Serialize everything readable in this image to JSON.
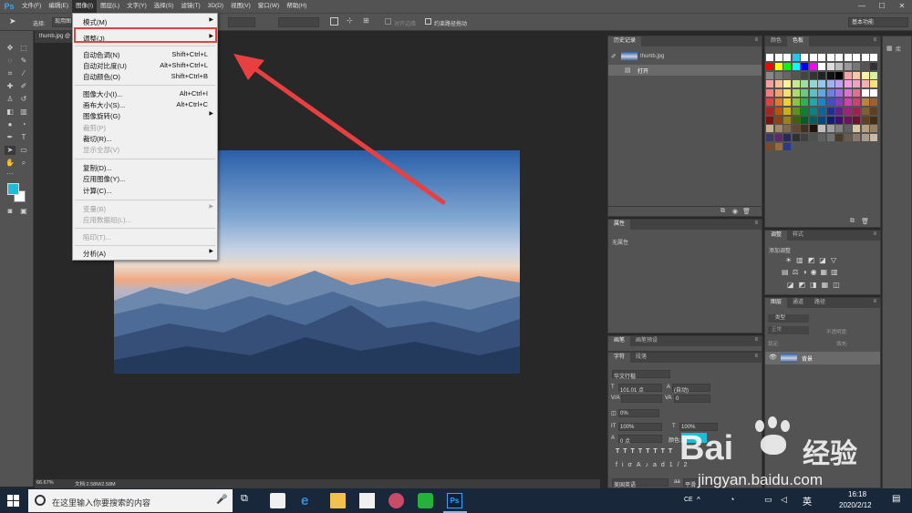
{
  "menubar": {
    "logo": "Ps",
    "items": [
      "文件(F)",
      "编辑(E)",
      "图像(I)",
      "图层(L)",
      "文字(Y)",
      "选择(S)",
      "滤镜(T)",
      "3D(D)",
      "视图(V)",
      "窗口(W)",
      "帮助(H)"
    ],
    "active_index": 2,
    "window_controls": [
      "—",
      "☐",
      "✕"
    ]
  },
  "optionsbar": {
    "select_label": "选择:",
    "select_value": "现用图",
    "align_edges": "对齐边缘",
    "constrain_path": "约束路径拖动",
    "workspace": "基本功能"
  },
  "document": {
    "tab": "thumb.jpg @",
    "zoom": "66.67%",
    "doc_size": "文档:2.58M/2.58M"
  },
  "image_menu": {
    "items": [
      {
        "label": "模式(M)",
        "shortcut": "",
        "submenu": true,
        "disabled": false
      },
      {
        "label": "调整(J)",
        "shortcut": "",
        "submenu": true,
        "disabled": false,
        "highlighted": true
      },
      {
        "label": "自动色调(N)",
        "shortcut": "Shift+Ctrl+L",
        "submenu": false,
        "disabled": false
      },
      {
        "label": "自动对比度(U)",
        "shortcut": "Alt+Shift+Ctrl+L",
        "submenu": false,
        "disabled": false
      },
      {
        "label": "自动颜色(O)",
        "shortcut": "Shift+Ctrl+B",
        "submenu": false,
        "disabled": false
      },
      {
        "label": "图像大小(I)...",
        "shortcut": "Alt+Ctrl+I",
        "submenu": false,
        "disabled": false
      },
      {
        "label": "画布大小(S)...",
        "shortcut": "Alt+Ctrl+C",
        "submenu": false,
        "disabled": false
      },
      {
        "label": "图像旋转(G)",
        "shortcut": "",
        "submenu": true,
        "disabled": false
      },
      {
        "label": "裁剪(P)",
        "shortcut": "",
        "submenu": false,
        "disabled": true
      },
      {
        "label": "裁切(R)...",
        "shortcut": "",
        "submenu": false,
        "disabled": false
      },
      {
        "label": "显示全部(V)",
        "shortcut": "",
        "submenu": false,
        "disabled": true
      },
      {
        "label": "复制(D)...",
        "shortcut": "",
        "submenu": false,
        "disabled": false
      },
      {
        "label": "应用图像(Y)...",
        "shortcut": "",
        "submenu": false,
        "disabled": false
      },
      {
        "label": "计算(C)...",
        "shortcut": "",
        "submenu": false,
        "disabled": false
      },
      {
        "label": "变量(B)",
        "shortcut": "",
        "submenu": true,
        "disabled": true
      },
      {
        "label": "应用数据组(L)...",
        "shortcut": "",
        "submenu": false,
        "disabled": true
      },
      {
        "label": "陷印(T)...",
        "shortcut": "",
        "submenu": false,
        "disabled": true
      },
      {
        "label": "分析(A)",
        "shortcut": "",
        "submenu": true,
        "disabled": false
      }
    ]
  },
  "history_panel": {
    "tab": "历史记录",
    "snapshot": "thumb.jpg",
    "step": "打开"
  },
  "library_panel": {
    "tab": "库"
  },
  "color_panel": {
    "tabs": [
      "颜色",
      "色板"
    ]
  },
  "properties_panel": {
    "tab": "属性",
    "content": "无属性"
  },
  "adjustments_panel": {
    "tabs": [
      "调整",
      "样式"
    ],
    "add_label": "添加调整"
  },
  "layers_panel": {
    "tabs": [
      "图层",
      "通道",
      "路径"
    ],
    "kind": "类型",
    "mode": "正常",
    "opacity": "不透明度:",
    "lock": "锁定:",
    "fill": "填充:",
    "layer_name": "背景"
  },
  "brush_panel": {
    "tabs": [
      "画笔",
      "画笔预设"
    ]
  },
  "character_panel": {
    "tabs": [
      "字符",
      "段落"
    ],
    "font": "华文行楷",
    "size": "101.01 点",
    "leading": "(自动)",
    "tracking": "0",
    "kerning_label": "V/A",
    "scale_pct": "0%",
    "v_scale": "100%",
    "h_scale": "100%",
    "baseline": "0 点",
    "color_label": "颜色:",
    "lang": "美国英语",
    "aa": "平滑"
  },
  "taskbar": {
    "search_placeholder": "在这里输入你要搜索的内容",
    "ime": "CE",
    "lang": "英",
    "time": "16:18",
    "date": "2020/2/12"
  },
  "watermark": {
    "brand": "Bai",
    "brand_cn": "经验",
    "url": "jingyan.baidu.com"
  },
  "colors": {
    "fg": "#17c0d7",
    "accent_red": "#e84040"
  }
}
